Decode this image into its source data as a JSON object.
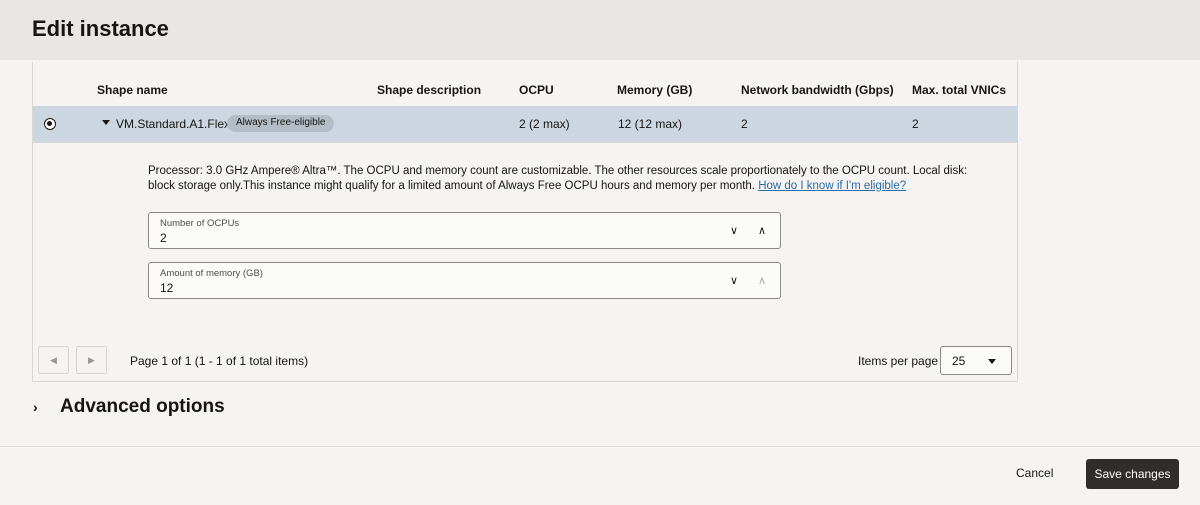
{
  "header": {
    "title": "Edit instance"
  },
  "table": {
    "columns": [
      "Shape name",
      "Shape description",
      "OCPU",
      "Memory (GB)",
      "Network bandwidth (Gbps)",
      "Max. total VNICs"
    ],
    "row": {
      "shape_name": "VM.Standard.A1.Flex",
      "badge": "Always Free-eligible",
      "ocpu": "2 (2 max)",
      "memory": "12 (12 max)",
      "bandwidth": "2",
      "vnics": "2"
    },
    "detail": {
      "description": "Processor: 3.0 GHz Ampere® Altra™. The OCPU and memory count are customizable. The other resources scale proportionately to the OCPU count. Local disk: block storage only.This instance might qualify for a limited amount of Always Free OCPU hours and memory per month.",
      "link": "How do I know if I'm eligible?",
      "ocpu_field": {
        "label": "Number of OCPUs",
        "value": "2"
      },
      "memory_field": {
        "label": "Amount of memory (GB)",
        "value": "12"
      }
    },
    "pagination": {
      "page_text": "Page 1 of 1 (1 - 1 of 1 total items)",
      "items_per_page_label": "Items per page",
      "items_per_page_value": "25"
    }
  },
  "advanced": {
    "title": "Advanced options"
  },
  "footer": {
    "cancel_label": "Cancel",
    "save_label": "Save changes"
  }
}
